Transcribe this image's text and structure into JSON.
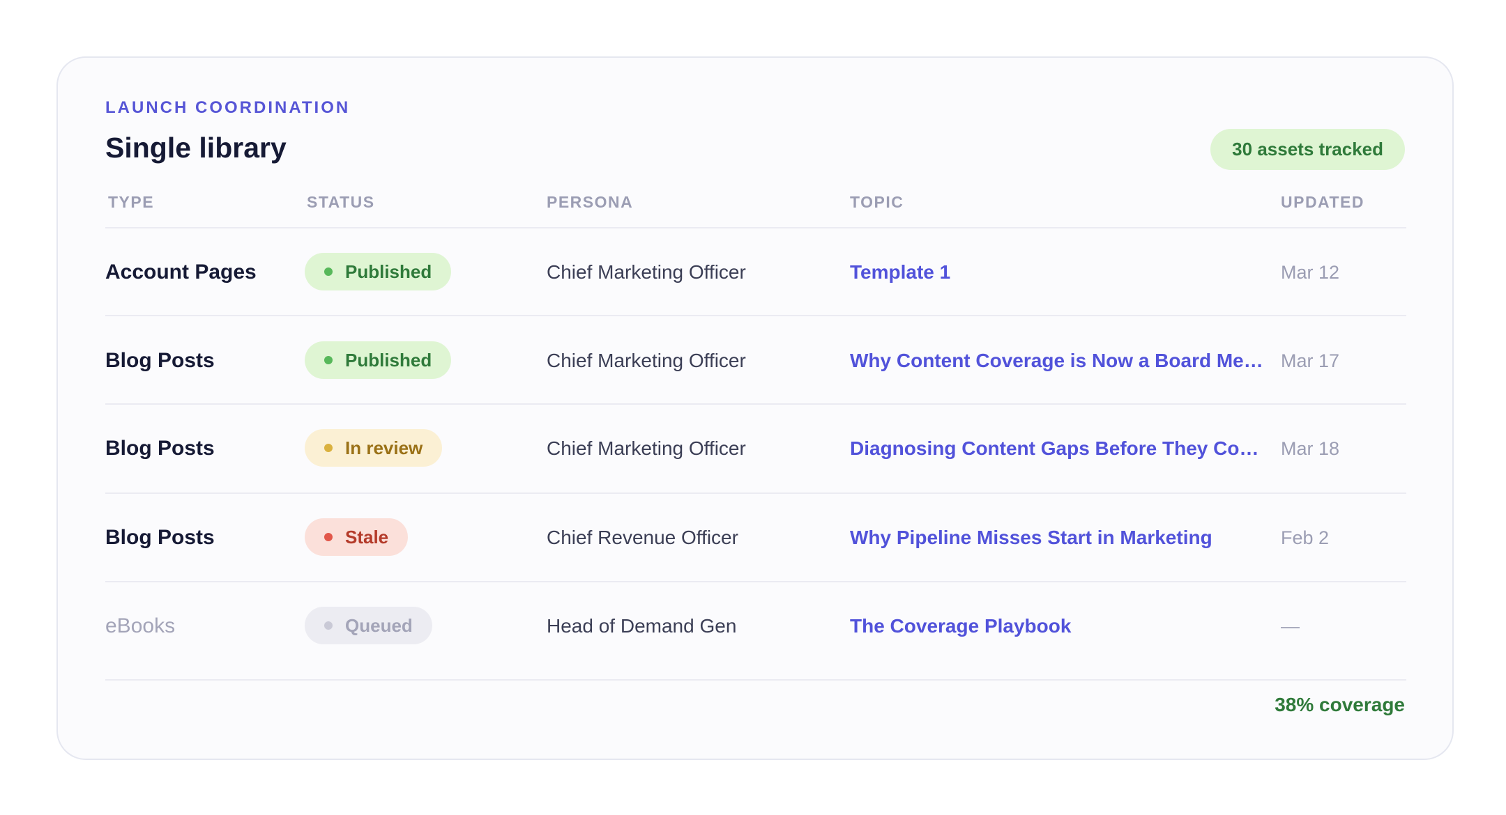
{
  "card": {
    "eyebrow": "LAUNCH COORDINATION",
    "title": "Single library",
    "assets_badge": "30 assets tracked"
  },
  "table": {
    "headers": [
      "TYPE",
      "STATUS",
      "PERSONA",
      "TOPIC",
      "UPDATED"
    ],
    "rows": [
      {
        "type": "Account Pages",
        "status": "Published",
        "status_kind": "published",
        "persona": "Chief Marketing Officer",
        "topic": "Template 1",
        "updated": "Mar 12"
      },
      {
        "type": "Blog Posts",
        "status": "Published",
        "status_kind": "published",
        "persona": "Chief Marketing Officer",
        "topic": "Why Content Coverage is Now a Board Metric",
        "updated": "Mar 17"
      },
      {
        "type": "Blog Posts",
        "status": "In review",
        "status_kind": "review",
        "persona": "Chief Marketing Officer",
        "topic": "Diagnosing Content Gaps Before They Cost ...",
        "updated": "Mar 18"
      },
      {
        "type": "Blog Posts",
        "status": "Stale",
        "status_kind": "stale",
        "persona": "Chief Revenue Officer",
        "topic": "Why Pipeline Misses Start in Marketing",
        "updated": "Feb 2"
      },
      {
        "type": "eBooks",
        "status": "Queued",
        "status_kind": "queued",
        "persona": "Head of Demand Gen",
        "topic": "The Coverage Playbook",
        "updated": "—"
      }
    ]
  },
  "footer": {
    "coverage": "38% coverage"
  },
  "colors": {
    "accent": "#5152da",
    "published": "#2f7a3a",
    "review": "#9a7117",
    "stale": "#b43b2a",
    "queued": "#a3a4b8"
  }
}
